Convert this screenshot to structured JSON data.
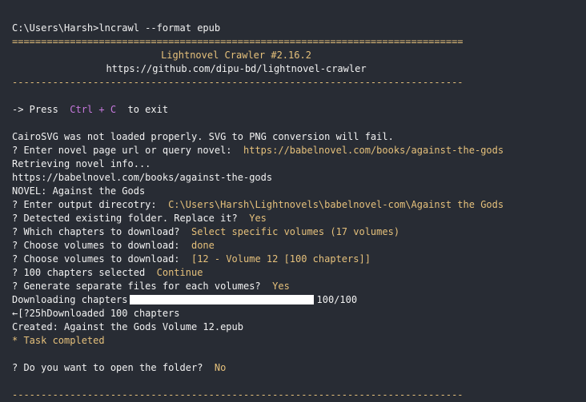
{
  "prompt_cmd": "C:\\Users\\Harsh>lncrawl --format epub",
  "separator_double": "==============================================================================",
  "separator_single": "------------------------------------------------------------------------------",
  "banner": {
    "title": "Lightnovel Crawler #2.16.2",
    "url": "https://github.com/dipu-bd/lightnovel-crawler"
  },
  "exit_hint": {
    "prefix": "-> Press",
    "keys": "Ctrl + C",
    "suffix": "to exit"
  },
  "log": {
    "cairo_warning": "CairoSVG was not loaded properly. SVG to PNG conversion will fail.",
    "q_url": "? Enter novel page url or query novel:",
    "a_url": "https://babelnovel.com/books/against-the-gods",
    "retrieving": "Retrieving novel info...",
    "retrieving_url": "https://babelnovel.com/books/against-the-gods",
    "novel": "NOVEL: Against the Gods",
    "q_dir": "? Enter output direcotry:",
    "a_dir": "C:\\Users\\Harsh\\Lightnovels\\babelnovel-com\\Against the Gods",
    "q_replace": "? Detected existing folder. Replace it?",
    "a_replace": "Yes",
    "q_which": "? Which chapters to download?",
    "a_which": "Select specific volumes (17 volumes)",
    "q_vol1": "? Choose volumes to download:",
    "a_vol1": "done",
    "q_vol2": "? Choose volumes to download:",
    "a_vol2": "[12 - Volume 12 [100 chapters]]",
    "q_selected": "? 100 chapters selected",
    "a_selected": "Continue",
    "q_separate": "? Generate separate files for each volumes?",
    "a_separate": "Yes",
    "downloading_label": "Downloading chapters",
    "progress_count": "100/100",
    "progress_fraction": 1.0,
    "downloaded": "←[?25hDownloaded 100 chapters",
    "created": "Created: Against the Gods Volume 12.epub",
    "task_completed": "* Task completed",
    "q_open": "? Do you want to open the folder?",
    "a_open": "No"
  },
  "colors": {
    "background": "#282c34",
    "text": "#f2f2f2",
    "highlight": "#e5c07b",
    "key": "#c678dd"
  }
}
